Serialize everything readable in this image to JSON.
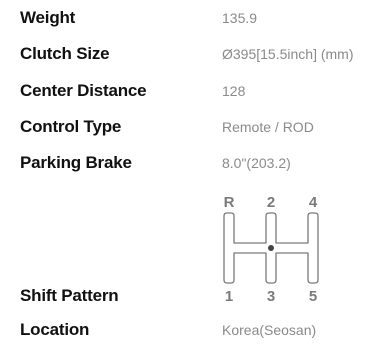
{
  "specs": [
    {
      "label": "Weight",
      "value": "135.9"
    },
    {
      "label": "Clutch Size",
      "value": "Ø395[15.5inch] (mm)"
    },
    {
      "label": "Center Distance",
      "value": "128"
    },
    {
      "label": "Control Type",
      "value": "Remote / ROD"
    },
    {
      "label": "Parking Brake",
      "value": "8.0\"(203.2)"
    }
  ],
  "shift_pattern": {
    "label": "Shift Pattern",
    "top_gears": [
      "R",
      "2",
      "4"
    ],
    "bottom_gears": [
      "1",
      "3",
      "5"
    ],
    "icon": "shift-pattern-h-gate-icon"
  },
  "location": {
    "label": "Location",
    "value": "Korea(Seosan)"
  },
  "colors": {
    "label_text": "#111111",
    "value_text": "#8a8a8a",
    "diagram_stroke": "#7a7a7a"
  }
}
